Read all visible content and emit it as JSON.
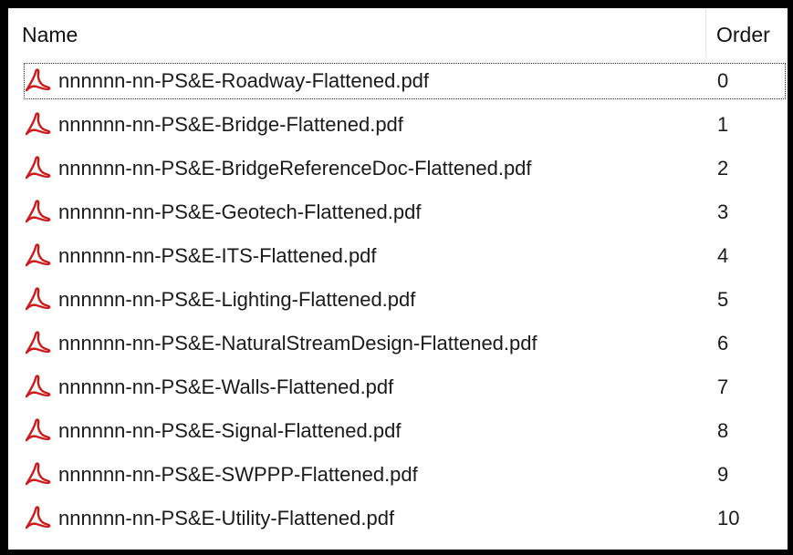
{
  "header": {
    "name_label": "Name",
    "order_label": "Order"
  },
  "icon": {
    "name": "pdf-icon",
    "color": "#cc1a1a"
  },
  "files": [
    {
      "name": "nnnnnn-nn-PS&E-Roadway-Flattened.pdf",
      "order": "0"
    },
    {
      "name": "nnnnnn-nn-PS&E-Bridge-Flattened.pdf",
      "order": "1"
    },
    {
      "name": "nnnnnn-nn-PS&E-BridgeReferenceDoc-Flattened.pdf",
      "order": "2"
    },
    {
      "name": "nnnnnn-nn-PS&E-Geotech-Flattened.pdf",
      "order": "3"
    },
    {
      "name": "nnnnnn-nn-PS&E-ITS-Flattened.pdf",
      "order": "4"
    },
    {
      "name": "nnnnnn-nn-PS&E-Lighting-Flattened.pdf",
      "order": "5"
    },
    {
      "name": "nnnnnn-nn-PS&E-NaturalStreamDesign-Flattened.pdf",
      "order": "6"
    },
    {
      "name": "nnnnnn-nn-PS&E-Walls-Flattened.pdf",
      "order": "7"
    },
    {
      "name": "nnnnnn-nn-PS&E-Signal-Flattened.pdf",
      "order": "8"
    },
    {
      "name": "nnnnnn-nn-PS&E-SWPPP-Flattened.pdf",
      "order": "9"
    },
    {
      "name": "nnnnnn-nn-PS&E-Utility-Flattened.pdf",
      "order": "10"
    }
  ]
}
